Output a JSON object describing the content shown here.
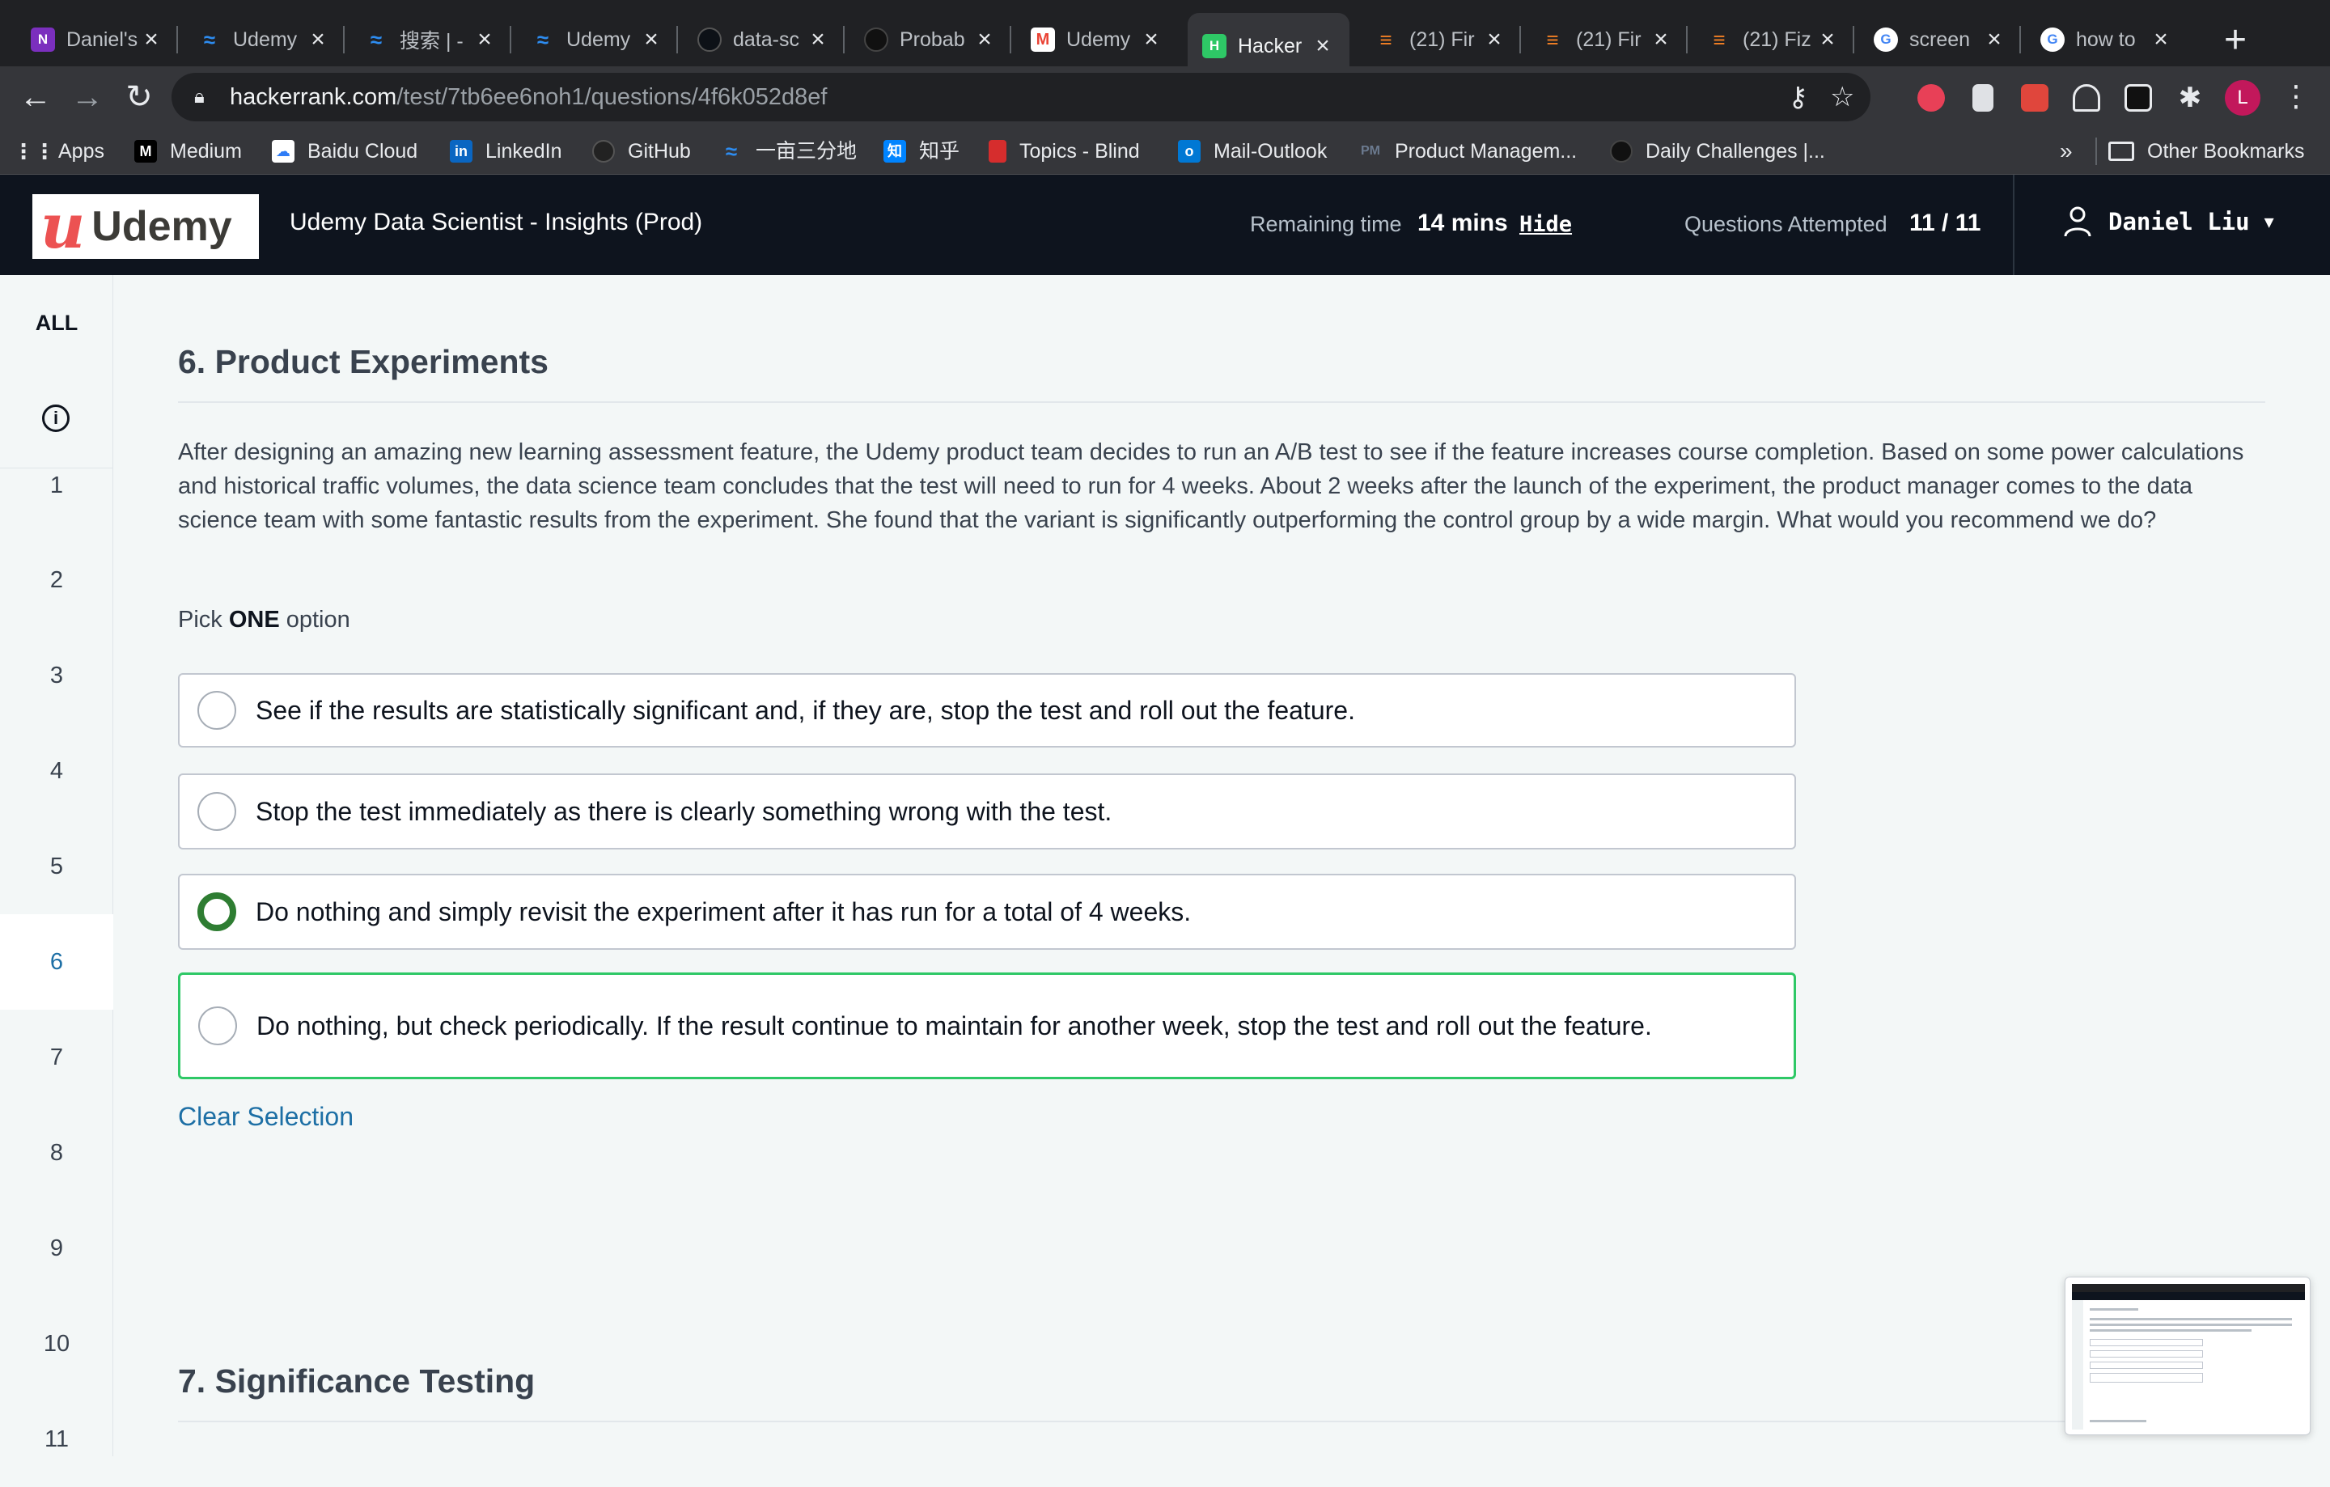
{
  "browser": {
    "tabs": [
      {
        "title": "Daniel's",
        "favicon": "onenote-icon",
        "color": "#7b2fbe"
      },
      {
        "title": "Udemy",
        "favicon": "udemy-bird-icon",
        "color": "#2d8cf0"
      },
      {
        "title": "搜索 | -",
        "favicon": "udemy-bird-icon",
        "color": "#2d8cf0"
      },
      {
        "title": "Udemy",
        "favicon": "udemy-bird-icon",
        "color": "#2d8cf0"
      },
      {
        "title": "data-sc",
        "favicon": "github-icon",
        "color": "#24292e"
      },
      {
        "title": "Probab",
        "favicon": "openai-icon",
        "color": "#10a37f"
      },
      {
        "title": "Udemy",
        "favicon": "gmail-icon",
        "color": "#ea4335"
      },
      {
        "title": "Hacker",
        "favicon": "hackerrank-icon",
        "color": "#2ec866"
      },
      {
        "title": "(21) Fir",
        "favicon": "stackoverflow-icon",
        "color": "#f48024"
      },
      {
        "title": "(21) Fir",
        "favicon": "stackoverflow-icon",
        "color": "#f48024"
      },
      {
        "title": "(21) Fiz",
        "favicon": "stackoverflow-icon",
        "color": "#f48024"
      },
      {
        "title": "screen",
        "favicon": "google-icon",
        "color": "#4285f4"
      },
      {
        "title": "how to",
        "favicon": "google-icon",
        "color": "#4285f4"
      }
    ],
    "active_tab_index": 7,
    "url_host": "hackerrank.com",
    "url_path": "/test/7tb6ee6noh1/questions/4f6k052d8ef",
    "avatar_letter": "L",
    "bookmarks": [
      {
        "label": "Apps",
        "icon": "apps-grid-icon"
      },
      {
        "label": "Medium",
        "icon": "medium-icon"
      },
      {
        "label": "Baidu Cloud",
        "icon": "baidu-cloud-icon"
      },
      {
        "label": "LinkedIn",
        "icon": "linkedin-icon"
      },
      {
        "label": "GitHub",
        "icon": "github-icon"
      },
      {
        "label": "一亩三分地",
        "icon": "udemy-bird-icon"
      },
      {
        "label": "知乎",
        "icon": "zhihu-icon"
      },
      {
        "label": "Topics - Blind",
        "icon": "blind-icon"
      },
      {
        "label": "Mail-Outlook",
        "icon": "outlook-icon"
      },
      {
        "label": "Product Managem...",
        "icon": "pm-icon"
      },
      {
        "label": "Daily Challenges |...",
        "icon": "challenge-icon"
      }
    ],
    "overflow_label": "»",
    "other_bookmarks": "Other Bookmarks"
  },
  "header": {
    "logo_text": "Udemy",
    "test_title": "Udemy Data Scientist - Insights (Prod)",
    "remaining_label": "Remaining time",
    "remaining_value": "14 mins",
    "hide_label": "Hide",
    "attempted_label": "Questions Attempted",
    "attempted_value": "11 / 11",
    "user_name": "Daniel Liu"
  },
  "qnav": {
    "all_label": "ALL",
    "items": [
      "1",
      "2",
      "3",
      "4",
      "5",
      "6",
      "7",
      "8",
      "9",
      "10",
      "11"
    ],
    "active": "6"
  },
  "question": {
    "title": "6. Product Experiments",
    "body": "After designing an amazing new learning assessment  feature, the Udemy product team decides to run an A/B test to see if the feature increases course completion. Based on some power calculations and historical traffic volumes, the data science team concludes that the test will need to run for 4 weeks. About 2 weeks after the launch of the experiment, the product manager comes to the data science team with some fantastic results from the experiment. She found that the variant is significantly outperforming the control group by a wide margin. What would you recommend we do?",
    "pick_prefix": "Pick ",
    "pick_bold": "ONE",
    "pick_suffix": " option",
    "options": [
      "See if the results are statistically significant and, if they are, stop the test and roll out the feature.",
      "Stop the test immediately as there is clearly something wrong with the test.",
      "Do nothing and simply revisit the experiment after it has run for a total of 4 weeks.",
      "Do nothing, but check periodically. If the result continue to maintain for another week, stop the test and roll out the feature."
    ],
    "selected_index": 2,
    "clear_label": "Clear Selection"
  },
  "next_question": {
    "title": "7. Significance Testing"
  }
}
